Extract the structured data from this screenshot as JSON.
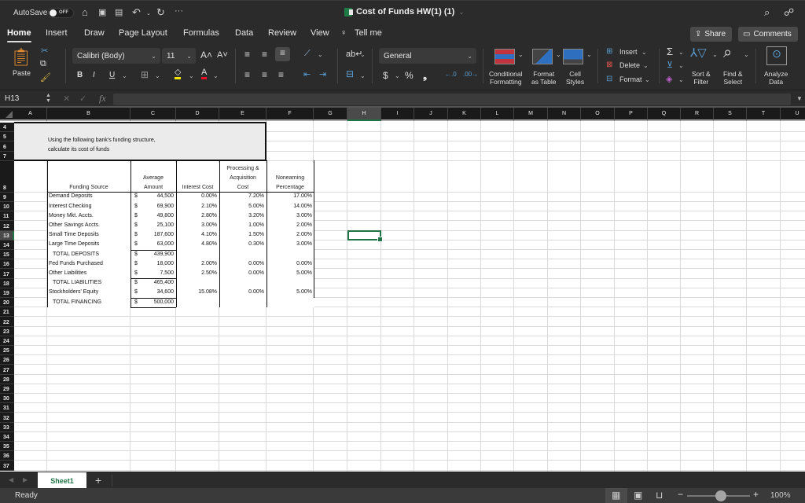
{
  "titlebar": {
    "autosave_label": "AutoSave",
    "autosave_state": "OFF",
    "document_title": "Cost of Funds HW(1) (1)",
    "icons": [
      "home-icon",
      "save-icon",
      "save-as-icon",
      "undo-icon",
      "redo-icon",
      "more-icon",
      "search-icon",
      "collaborate-icon"
    ]
  },
  "menu": {
    "tabs": [
      {
        "label": "Home",
        "active": true
      },
      {
        "label": "Insert"
      },
      {
        "label": "Draw"
      },
      {
        "label": "Page Layout"
      },
      {
        "label": "Formulas"
      },
      {
        "label": "Data"
      },
      {
        "label": "Review"
      },
      {
        "label": "View"
      }
    ],
    "tell_me": "Tell me",
    "share_label": "Share",
    "comments_label": "Comments"
  },
  "ribbon": {
    "paste_label": "Paste",
    "font_name": "Calibri (Body)",
    "font_size": "11",
    "bold": "B",
    "italic": "I",
    "underline": "U",
    "number_format": "General",
    "currency": "$",
    "percent": "%",
    "comma": "❟",
    "conditional_formatting": [
      "Conditional",
      "Formatting"
    ],
    "format_as_table": [
      "Format",
      "as Table"
    ],
    "cell_styles": [
      "Cell",
      "Styles"
    ],
    "insert_label": "Insert",
    "delete_label": "Delete",
    "format_label": "Format",
    "sort_filter": [
      "Sort &",
      "Filter"
    ],
    "find_select": [
      "Find &",
      "Select"
    ],
    "analyze_data": [
      "Analyze",
      "Data"
    ],
    "colors": {
      "highlight": "#f5e600",
      "font_color": "#e81123"
    }
  },
  "formula_bar": {
    "name_box": "H13",
    "fx": "fx",
    "value": ""
  },
  "grid": {
    "columns": [
      "A",
      "B",
      "C",
      "D",
      "E",
      "F",
      "G",
      "H",
      "I",
      "J",
      "K",
      "L",
      "M",
      "N",
      "O",
      "P",
      "Q",
      "R",
      "S",
      "T",
      "U"
    ],
    "selected_column": "H",
    "selected_row": "13",
    "rows": [
      "4",
      "5",
      "6",
      "7",
      "8",
      "9",
      "10",
      "11",
      "12",
      "13",
      "14",
      "15",
      "16",
      "17",
      "18",
      "19",
      "20",
      "21",
      "22",
      "23",
      "24",
      "25",
      "26",
      "27",
      "28",
      "29",
      "30",
      "31",
      "32",
      "33",
      "34",
      "35",
      "36",
      "37"
    ],
    "instructions": [
      "Using the following bank's funding structure,",
      "calculate its cost of funds"
    ],
    "headers": {
      "funding_source": "Funding Source",
      "average_amount": [
        "Average",
        "Amount"
      ],
      "interest_cost": "Interest Cost",
      "processing_cost": [
        "Processing &",
        "Acquisition",
        "Cost"
      ],
      "nonearning_pct": [
        "Nonearning",
        "Percentage"
      ]
    },
    "table": [
      {
        "source": "Demand Deposits",
        "currency": "$",
        "amount": "44,500",
        "interest": "0.00%",
        "processing": "7.20%",
        "nonearning": "17.00%"
      },
      {
        "source": "Interest Checking",
        "currency": "$",
        "amount": "69,900",
        "interest": "2.10%",
        "processing": "5.00%",
        "nonearning": "14.00%"
      },
      {
        "source": "Money Mkt. Accts.",
        "currency": "$",
        "amount": "49,800",
        "interest": "2.80%",
        "processing": "3.20%",
        "nonearning": "3.00%"
      },
      {
        "source": "Other Savings Accts.",
        "currency": "$",
        "amount": "25,100",
        "interest": "3.00%",
        "processing": "1.00%",
        "nonearning": "2.00%"
      },
      {
        "source": "Small Time Deposits",
        "currency": "$",
        "amount": "187,600",
        "interest": "4.10%",
        "processing": "1.50%",
        "nonearning": "2.00%"
      },
      {
        "source": "Large Time Deposits",
        "currency": "$",
        "amount": "63,000",
        "interest": "4.80%",
        "processing": "0.30%",
        "nonearning": "3.00%"
      },
      {
        "source": "TOTAL DEPOSITS",
        "currency": "$",
        "amount": "439,900",
        "interest": "",
        "processing": "",
        "nonearning": "",
        "total": true
      },
      {
        "source": "Fed Funds Purchased",
        "currency": "$",
        "amount": "18,000",
        "interest": "2.00%",
        "processing": "0.00%",
        "nonearning": "0.00%"
      },
      {
        "source": "Other Liabilities",
        "currency": "$",
        "amount": "7,500",
        "interest": "2.50%",
        "processing": "0.00%",
        "nonearning": "5.00%"
      },
      {
        "source": "TOTAL LIABILITIES",
        "currency": "$",
        "amount": "465,400",
        "interest": "",
        "processing": "",
        "nonearning": "",
        "total": true
      },
      {
        "source": "Stockholders' Equity",
        "currency": "$",
        "amount": "34,600",
        "interest": "15.08%",
        "processing": "0.00%",
        "nonearning": "5.00%"
      },
      {
        "source": "TOTAL FINANCING",
        "currency": "$",
        "amount": "500,000",
        "interest": "",
        "processing": "",
        "nonearning": "",
        "total": true
      }
    ]
  },
  "sheets": {
    "tabs": [
      "Sheet1"
    ],
    "add_label": "+"
  },
  "status": {
    "text": "Ready",
    "zoom": "100%",
    "zoom_fraction": 0.5
  }
}
